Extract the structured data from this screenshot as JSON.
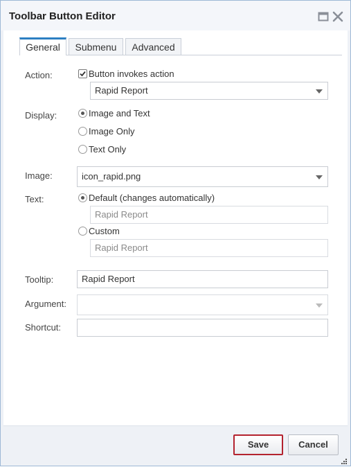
{
  "window": {
    "title": "Toolbar Button Editor"
  },
  "tabs": [
    {
      "label": "General",
      "active": true
    },
    {
      "label": "Submenu",
      "active": false
    },
    {
      "label": "Advanced",
      "active": false
    }
  ],
  "form": {
    "action": {
      "label": "Action:",
      "checkbox_label": "Button invokes action",
      "checked": true,
      "select_value": "Rapid Report"
    },
    "display": {
      "label": "Display:",
      "options": [
        "Image and Text",
        "Image Only",
        "Text Only"
      ],
      "selected": "Image and Text"
    },
    "image": {
      "label": "Image:",
      "value": "icon_rapid.png"
    },
    "text": {
      "label": "Text:",
      "default_label": "Default (changes automatically)",
      "default_value": "Rapid Report",
      "custom_label": "Custom",
      "custom_value": "Rapid Report",
      "selected": "default"
    },
    "tooltip": {
      "label": "Tooltip:",
      "value": "Rapid Report"
    },
    "argument": {
      "label": "Argument:",
      "value": ""
    },
    "shortcut": {
      "label": "Shortcut:",
      "value": ""
    }
  },
  "buttons": {
    "save": "Save",
    "cancel": "Cancel"
  },
  "colors": {
    "accent_tab": "#2c7fc2",
    "save_border": "#b3222e",
    "window_border": "#9db8d6"
  }
}
